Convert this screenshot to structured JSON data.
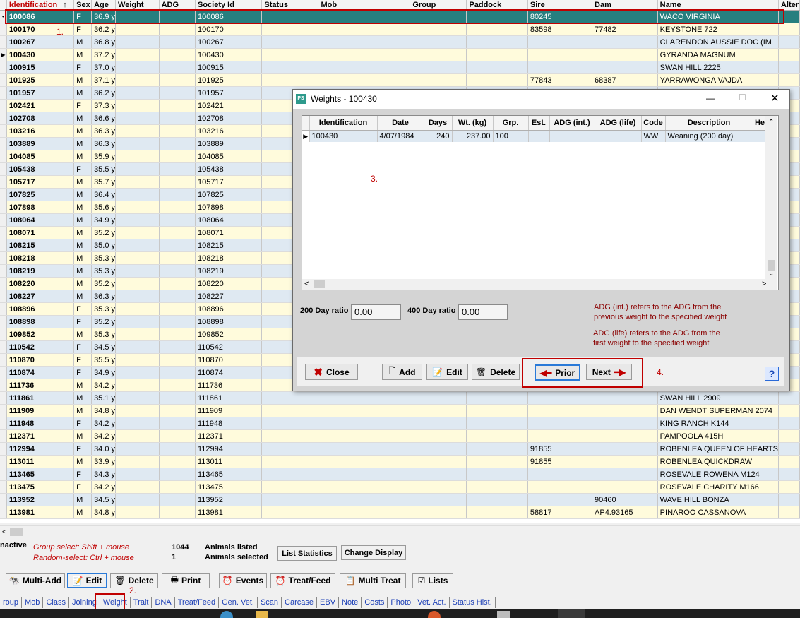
{
  "grid": {
    "columns": [
      {
        "label": "Identification",
        "sort": "↑"
      },
      {
        "label": "Sex"
      },
      {
        "label": "Age"
      },
      {
        "label": "Weight"
      },
      {
        "label": "ADG"
      },
      {
        "label": "Society Id"
      },
      {
        "label": "Status"
      },
      {
        "label": "Mob"
      },
      {
        "label": "Group"
      },
      {
        "label": "Paddock"
      },
      {
        "label": "Sire"
      },
      {
        "label": "Dam"
      },
      {
        "label": "Name"
      },
      {
        "label": "Alter"
      }
    ],
    "rows": [
      [
        "100086",
        "F",
        "36.9 y",
        "",
        "",
        "100086",
        "",
        "",
        "",
        "",
        "80245",
        "",
        "WACO VIRGINIA"
      ],
      [
        "100170",
        "F",
        "36.2 y",
        "",
        "",
        "100170",
        "",
        "",
        "",
        "",
        "83598",
        "77482",
        "KEYSTONE 722"
      ],
      [
        "100267",
        "M",
        "36.8 y",
        "",
        "",
        "100267",
        "",
        "",
        "",
        "",
        "",
        "",
        "CLARENDON AUSSIE DOC (IM"
      ],
      [
        "100430",
        "M",
        "37.2 y",
        "",
        "",
        "100430",
        "",
        "",
        "",
        "",
        "",
        "",
        "GYRANDA MAGNUM"
      ],
      [
        "100915",
        "F",
        "37.0 y",
        "",
        "",
        "100915",
        "",
        "",
        "",
        "",
        "",
        "",
        "SWAN HILL 2225"
      ],
      [
        "101925",
        "M",
        "37.1 y",
        "",
        "",
        "101925",
        "",
        "",
        "",
        "",
        "77843",
        "68387",
        "YARRAWONGA VAJDA"
      ],
      [
        "101957",
        "M",
        "36.2 y",
        "",
        "",
        "101957",
        "",
        "",
        "",
        "",
        "",
        "",
        ""
      ],
      [
        "102421",
        "F",
        "37.3 y",
        "",
        "",
        "102421",
        "",
        "",
        "",
        "",
        "",
        "",
        ""
      ],
      [
        "102708",
        "M",
        "36.6 y",
        "",
        "",
        "102708",
        "",
        "",
        "",
        "",
        "",
        "",
        ""
      ],
      [
        "103216",
        "M",
        "36.3 y",
        "",
        "",
        "103216",
        "",
        "",
        "",
        "",
        "",
        "",
        ""
      ],
      [
        "103889",
        "M",
        "36.3 y",
        "",
        "",
        "103889",
        "",
        "",
        "",
        "",
        "",
        "",
        ""
      ],
      [
        "104085",
        "M",
        "35.9 y",
        "",
        "",
        "104085",
        "",
        "",
        "",
        "",
        "",
        "",
        ""
      ],
      [
        "105438",
        "F",
        "35.5 y",
        "",
        "",
        "105438",
        "",
        "",
        "",
        "",
        "",
        "",
        ""
      ],
      [
        "105717",
        "M",
        "35.7 y",
        "",
        "",
        "105717",
        "",
        "",
        "",
        "",
        "",
        "",
        ""
      ],
      [
        "107825",
        "M",
        "36.4 y",
        "",
        "",
        "107825",
        "",
        "",
        "",
        "",
        "",
        "",
        ""
      ],
      [
        "107898",
        "M",
        "35.6 y",
        "",
        "",
        "107898",
        "",
        "",
        "",
        "",
        "",
        "",
        ""
      ],
      [
        "108064",
        "M",
        "34.9 y",
        "",
        "",
        "108064",
        "",
        "",
        "",
        "",
        "",
        "",
        ""
      ],
      [
        "108071",
        "M",
        "35.2 y",
        "",
        "",
        "108071",
        "",
        "",
        "",
        "",
        "",
        "",
        ""
      ],
      [
        "108215",
        "M",
        "35.0 y",
        "",
        "",
        "108215",
        "",
        "",
        "",
        "",
        "",
        "",
        ""
      ],
      [
        "108218",
        "M",
        "35.3 y",
        "",
        "",
        "108218",
        "",
        "",
        "",
        "",
        "",
        "",
        ""
      ],
      [
        "108219",
        "M",
        "35.3 y",
        "",
        "",
        "108219",
        "",
        "",
        "",
        "",
        "",
        "",
        ""
      ],
      [
        "108220",
        "M",
        "35.2 y",
        "",
        "",
        "108220",
        "",
        "",
        "",
        "",
        "",
        "",
        ""
      ],
      [
        "108227",
        "M",
        "36.3 y",
        "",
        "",
        "108227",
        "",
        "",
        "",
        "",
        "",
        "",
        ""
      ],
      [
        "108896",
        "F",
        "35.3 y",
        "",
        "",
        "108896",
        "",
        "",
        "",
        "",
        "",
        "",
        ""
      ],
      [
        "108898",
        "F",
        "35.2 y",
        "",
        "",
        "108898",
        "",
        "",
        "",
        "",
        "",
        "",
        ""
      ],
      [
        "109852",
        "M",
        "35.3 y",
        "",
        "",
        "109852",
        "",
        "",
        "",
        "",
        "",
        "",
        ""
      ],
      [
        "110542",
        "F",
        "34.5 y",
        "",
        "",
        "110542",
        "",
        "",
        "",
        "",
        "",
        "",
        ""
      ],
      [
        "110870",
        "F",
        "35.5 y",
        "",
        "",
        "110870",
        "",
        "",
        "",
        "",
        "",
        "",
        ""
      ],
      [
        "110874",
        "F",
        "34.9 y",
        "",
        "",
        "110874",
        "",
        "",
        "",
        "",
        "",
        "",
        ""
      ],
      [
        "111736",
        "M",
        "34.2 y",
        "",
        "",
        "111736",
        "",
        "",
        "",
        "",
        "",
        "",
        ""
      ],
      [
        "111861",
        "M",
        "35.1 y",
        "",
        "",
        "111861",
        "",
        "",
        "",
        "",
        "",
        "",
        "SWAN HILL 2909"
      ],
      [
        "111909",
        "M",
        "34.8 y",
        "",
        "",
        "111909",
        "",
        "",
        "",
        "",
        "",
        "",
        "DAN WENDT SUPERMAN 2074"
      ],
      [
        "111948",
        "F",
        "34.2 y",
        "",
        "",
        "111948",
        "",
        "",
        "",
        "",
        "",
        "",
        "KING RANCH K144"
      ],
      [
        "112371",
        "M",
        "34.2 y",
        "",
        "",
        "112371",
        "",
        "",
        "",
        "",
        "",
        "",
        "PAMPOOLA 415H"
      ],
      [
        "112994",
        "F",
        "34.0 y",
        "",
        "",
        "112994",
        "",
        "",
        "",
        "",
        "91855",
        "",
        "ROBENLEA QUEEN OF HEARTS"
      ],
      [
        "113011",
        "M",
        "33.9 y",
        "",
        "",
        "113011",
        "",
        "",
        "",
        "",
        "91855",
        "",
        "ROBENLEA QUICKDRAW"
      ],
      [
        "113465",
        "F",
        "34.3 y",
        "",
        "",
        "113465",
        "",
        "",
        "",
        "",
        "",
        "",
        "ROSEVALE ROWENA M124"
      ],
      [
        "113475",
        "F",
        "34.2 y",
        "",
        "",
        "113475",
        "",
        "",
        "",
        "",
        "",
        "",
        "ROSEVALE CHARITY M166"
      ],
      [
        "113952",
        "M",
        "34.5 y",
        "",
        "",
        "113952",
        "",
        "",
        "",
        "",
        "",
        "90460",
        "WAVE HILL BONZA"
      ],
      [
        "113981",
        "M",
        "34.8 y",
        "",
        "",
        "113981",
        "",
        "",
        "",
        "",
        "58817",
        "AP4.93165",
        "PINAROO CASSANOVA"
      ]
    ],
    "row_markers": {
      "0": "•",
      "3": "▶"
    }
  },
  "annotations": {
    "a1": "1.",
    "a2": "2.",
    "a3": "3.",
    "a4": "4."
  },
  "status": {
    "inactive": "nactive",
    "group_select": "Group select: Shift + mouse",
    "random_select": "Random-select: Ctrl + mouse",
    "animals_listed_count": "1044",
    "animals_listed_label": "Animals listed",
    "animals_selected_count": "1",
    "animals_selected_label": "Animals selected",
    "list_statistics": "List Statistics",
    "change_display": "Change Display"
  },
  "toolbar": {
    "multi_add": "Multi-Add",
    "edit": "Edit",
    "delete": "Delete",
    "print": "Print",
    "events": "Events",
    "treat_feed": "Treat/Feed",
    "multi_treat": "Multi Treat",
    "lists": "Lists"
  },
  "tabs": [
    "roup",
    "Mob",
    "Class",
    "Joining",
    "Weight",
    "Trait",
    "DNA",
    "Treat/Feed",
    "Gen. Vet.",
    "Scan",
    "Carcase",
    "EBV",
    "Note",
    "Costs",
    "Photo",
    "Vet. Act.",
    "Status Hist."
  ],
  "dialog": {
    "app_icon": "PS",
    "title": "Weights - 100430",
    "minimize": "—",
    "maximize": "☐",
    "close": "✕",
    "columns": [
      "Identification",
      "Date",
      "Days",
      "Wt. (kg)",
      "Grp.",
      "Est.",
      "ADG (int.)",
      "ADG (life)",
      "Code",
      "Description",
      "He"
    ],
    "rows": [
      [
        "100430",
        "4/07/1984",
        "240",
        "237.00",
        "100",
        "",
        "",
        "",
        "WW",
        "Weaning (200 day)",
        ""
      ]
    ],
    "ratio200_label": "200 Day ratio",
    "ratio200_value": "0.00",
    "ratio400_label": "400 Day ratio",
    "ratio400_value": "0.00",
    "note1_line1": "ADG (int.) refers to the ADG from the",
    "note1_line2": "previous weight to the specified weight",
    "note2_line1": "ADG (life) refers to the ADG from the",
    "note2_line2": "first weight to the specified weight",
    "close_btn": "Close",
    "add_btn": "Add",
    "edit_btn": "Edit",
    "delete_btn": "Delete",
    "prior_btn": "Prior",
    "next_btn": "Next",
    "help": "?"
  },
  "colors": {
    "selected_row": "#267f7f",
    "odd_row": "#fffbdc",
    "even_row": "#dfe9f2",
    "annotation": "#c00000"
  }
}
